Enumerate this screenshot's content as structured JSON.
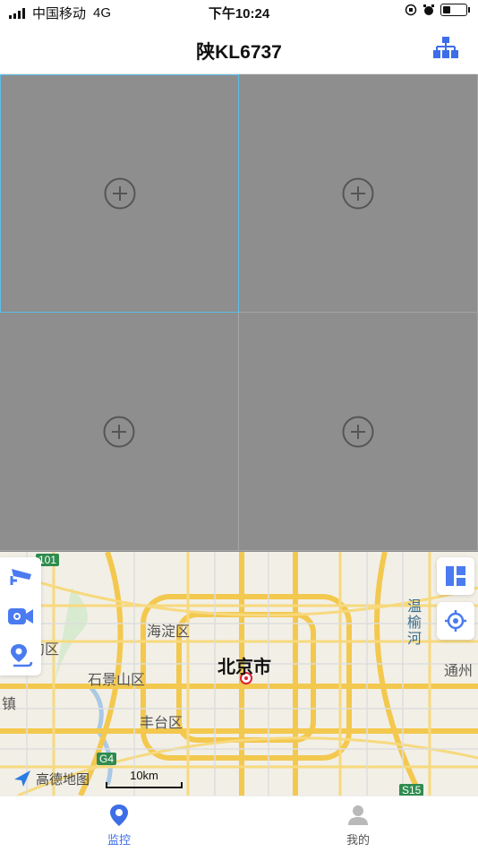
{
  "status": {
    "carrier": "中国移动",
    "network": "4G",
    "time": "下午10:24"
  },
  "header": {
    "title": "陕KL6737"
  },
  "grid": {
    "cells": 4,
    "selected": 1
  },
  "map": {
    "labels": {
      "haidian": "海淀区",
      "beijing": "北京市",
      "shijingshan": "石景山区",
      "fengtai": "丰台区",
      "tongzhou": "通州",
      "wenyu": "温榆河",
      "gou": "沟区",
      "zhen": "镇",
      "g4": "G4",
      "s15": "S15",
      "e01": "101"
    },
    "logo": "高德地图",
    "scale": "10km"
  },
  "tabs": [
    {
      "label": "监控",
      "active": true
    },
    {
      "label": "我的",
      "active": false
    }
  ],
  "colors": {
    "accent": "#3d6ee8",
    "road": "#f3c84e",
    "grid_bg": "#8e8e8e"
  }
}
